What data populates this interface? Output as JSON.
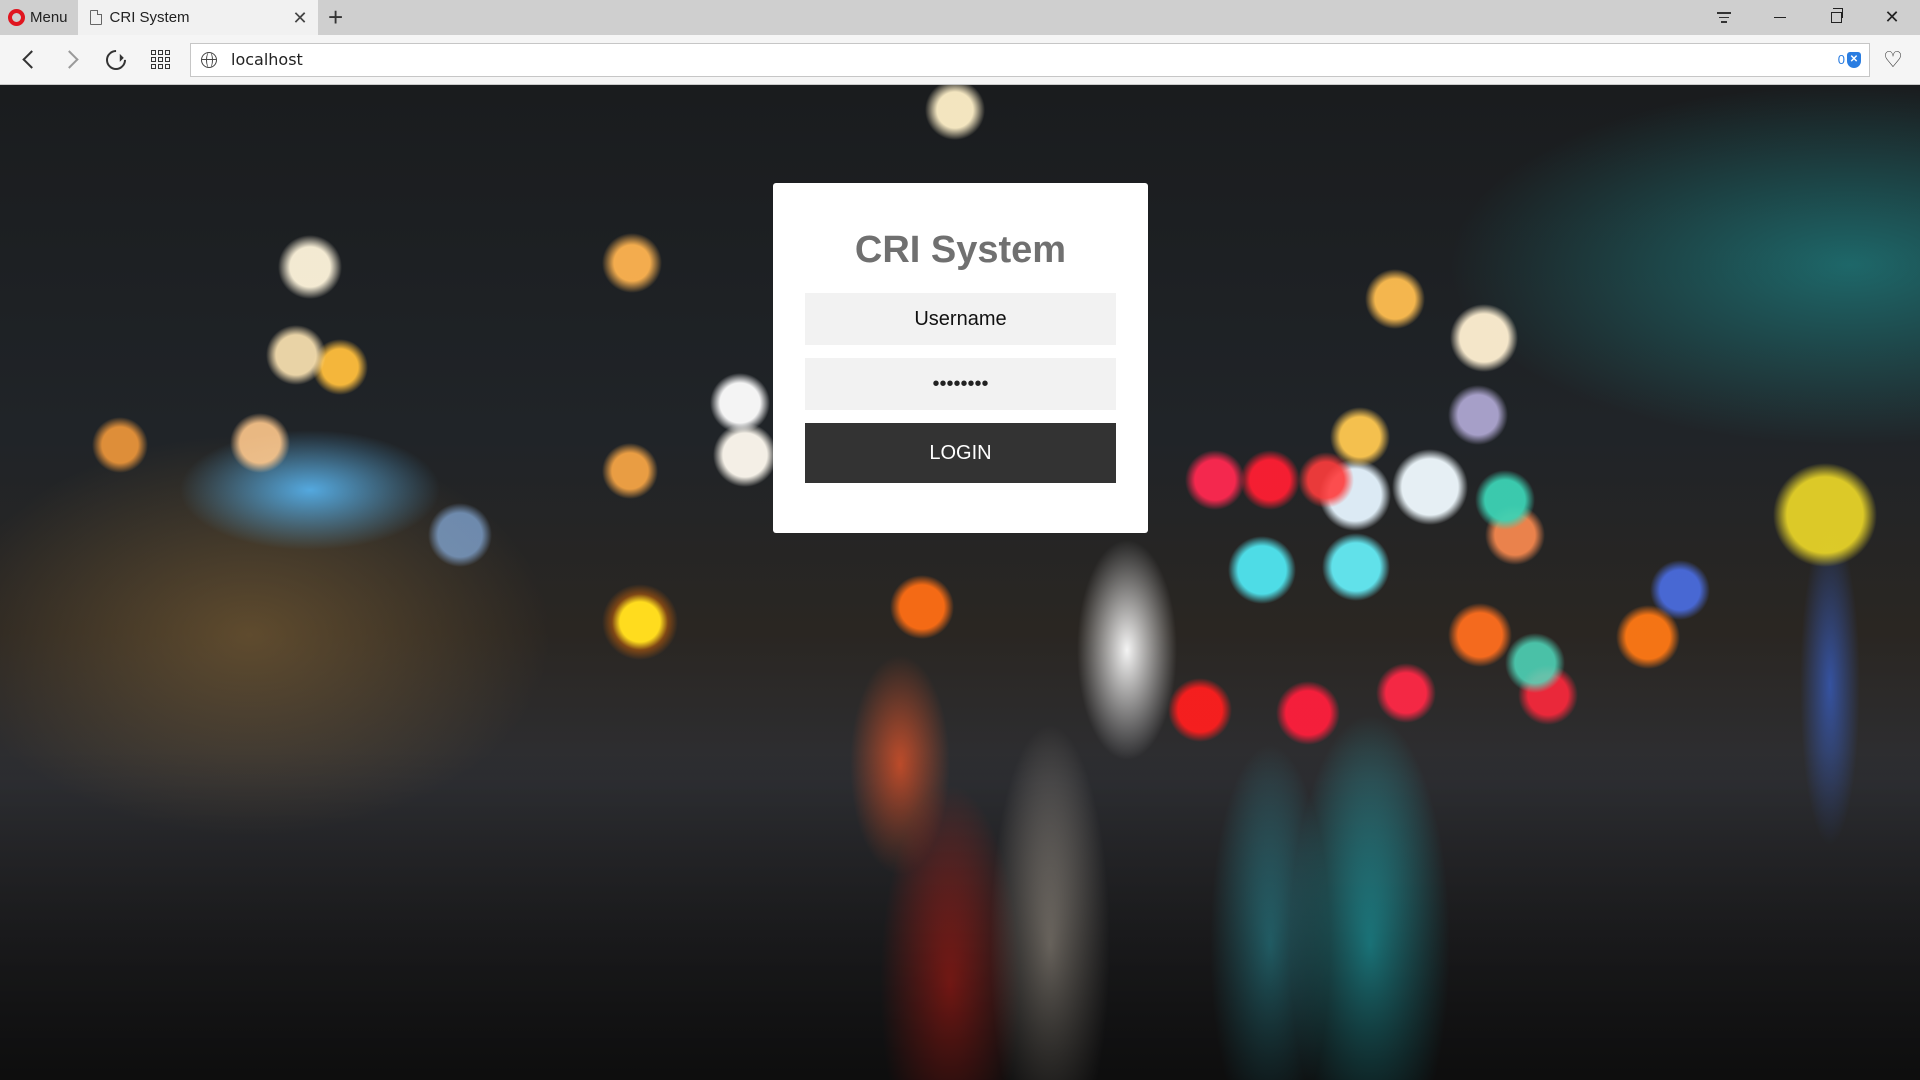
{
  "browser": {
    "menu_label": "Menu",
    "tab": {
      "title": "CRI System"
    },
    "address": {
      "url": "localhost"
    },
    "adblock_count": "0",
    "accent_color": "#e0151f"
  },
  "login": {
    "title": "CRI System",
    "username_placeholder": "Username",
    "password_value": "password",
    "button_label": "LOGIN",
    "button_color": "#333333"
  }
}
